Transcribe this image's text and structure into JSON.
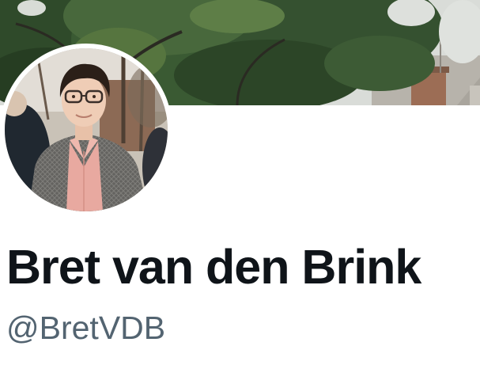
{
  "profile": {
    "display_name": "Bret van den Brink",
    "handle": "@BretVDB"
  },
  "header_image": {
    "description_icon": "header-photo-trees"
  },
  "avatar": {
    "icon": "profile-photo-avatar"
  },
  "colors": {
    "name_text": "#0f1419",
    "handle_text": "#536471",
    "background": "#ffffff"
  }
}
